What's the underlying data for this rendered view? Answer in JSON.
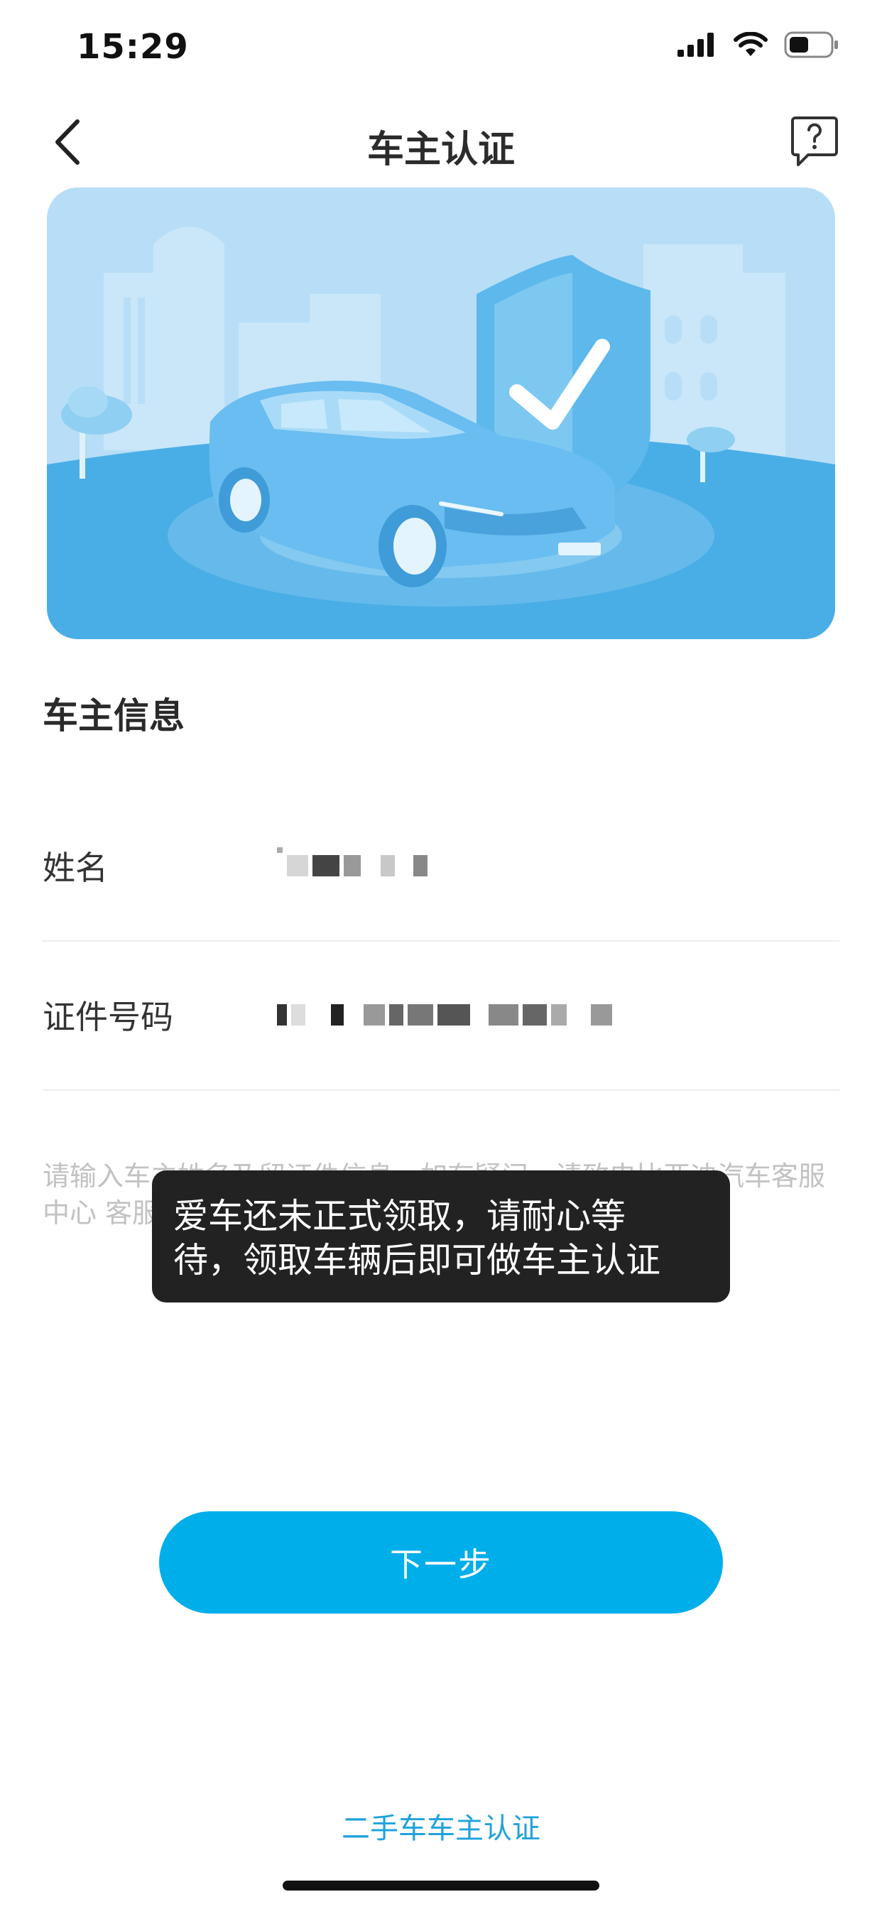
{
  "status_bar": {
    "time": "15:29"
  },
  "nav": {
    "title": "车主认证"
  },
  "form": {
    "section_title": "车主信息",
    "name_label": "姓名",
    "id_label": "证件号码"
  },
  "hint_text": "请输入车主姓名及留证件信息，如有疑问，请致电比亚迪汽车客服中心 客服电话",
  "toast": {
    "line1": "爱车还未正式领取，请耐心等",
    "line2": "待，领取车辆后即可做车主认证"
  },
  "next_button": "下一步",
  "used_car_link": "二手车车主认证",
  "colors": {
    "accent": "#00aeea",
    "link": "#1fa2dc",
    "toast_bg": "#222222"
  }
}
